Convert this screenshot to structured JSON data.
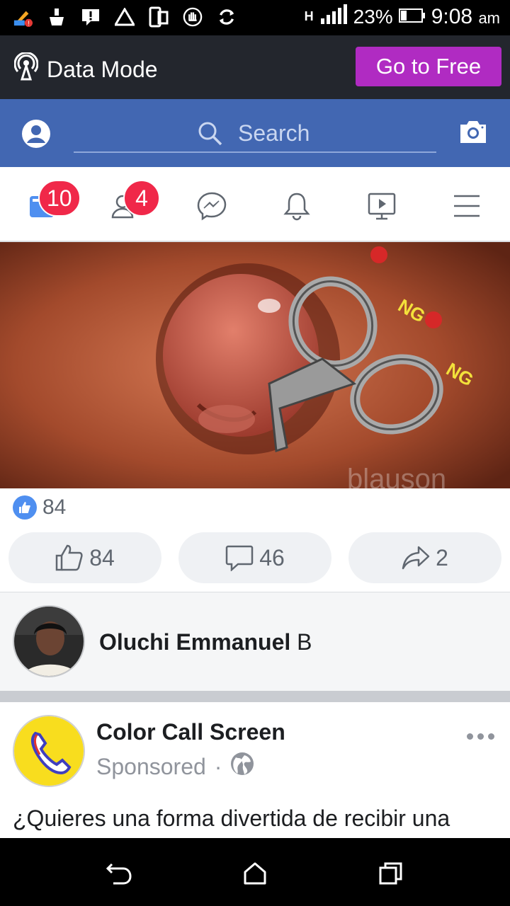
{
  "status_bar": {
    "network_type": "H",
    "battery": "23%",
    "time": "9:08",
    "ampm": "am"
  },
  "data_mode": {
    "label": "Data Mode",
    "button": "Go to Free"
  },
  "header": {
    "search_placeholder": "Search"
  },
  "tabs": {
    "news_feed_badge": "10",
    "friends_badge": "4"
  },
  "post": {
    "reaction_count": "84",
    "actions": {
      "like": "84",
      "comment": "46",
      "share": "2"
    },
    "image_overlay": {
      "text_1": "NG",
      "text_2": "NG",
      "watermark": "blauson"
    }
  },
  "comment": {
    "name": "Oluchi Emmanuel",
    "text": "B"
  },
  "sponsored_post": {
    "page_name": "Color Call Screen",
    "label": "Sponsored",
    "separator": "·",
    "text": "¿Quieres una forma divertida de recibir una"
  },
  "colors": {
    "facebook_blue": "#4267b2",
    "go_free_purple": "#b02bc2",
    "badge_red": "#f02849",
    "like_blue": "#4f8ff0"
  }
}
